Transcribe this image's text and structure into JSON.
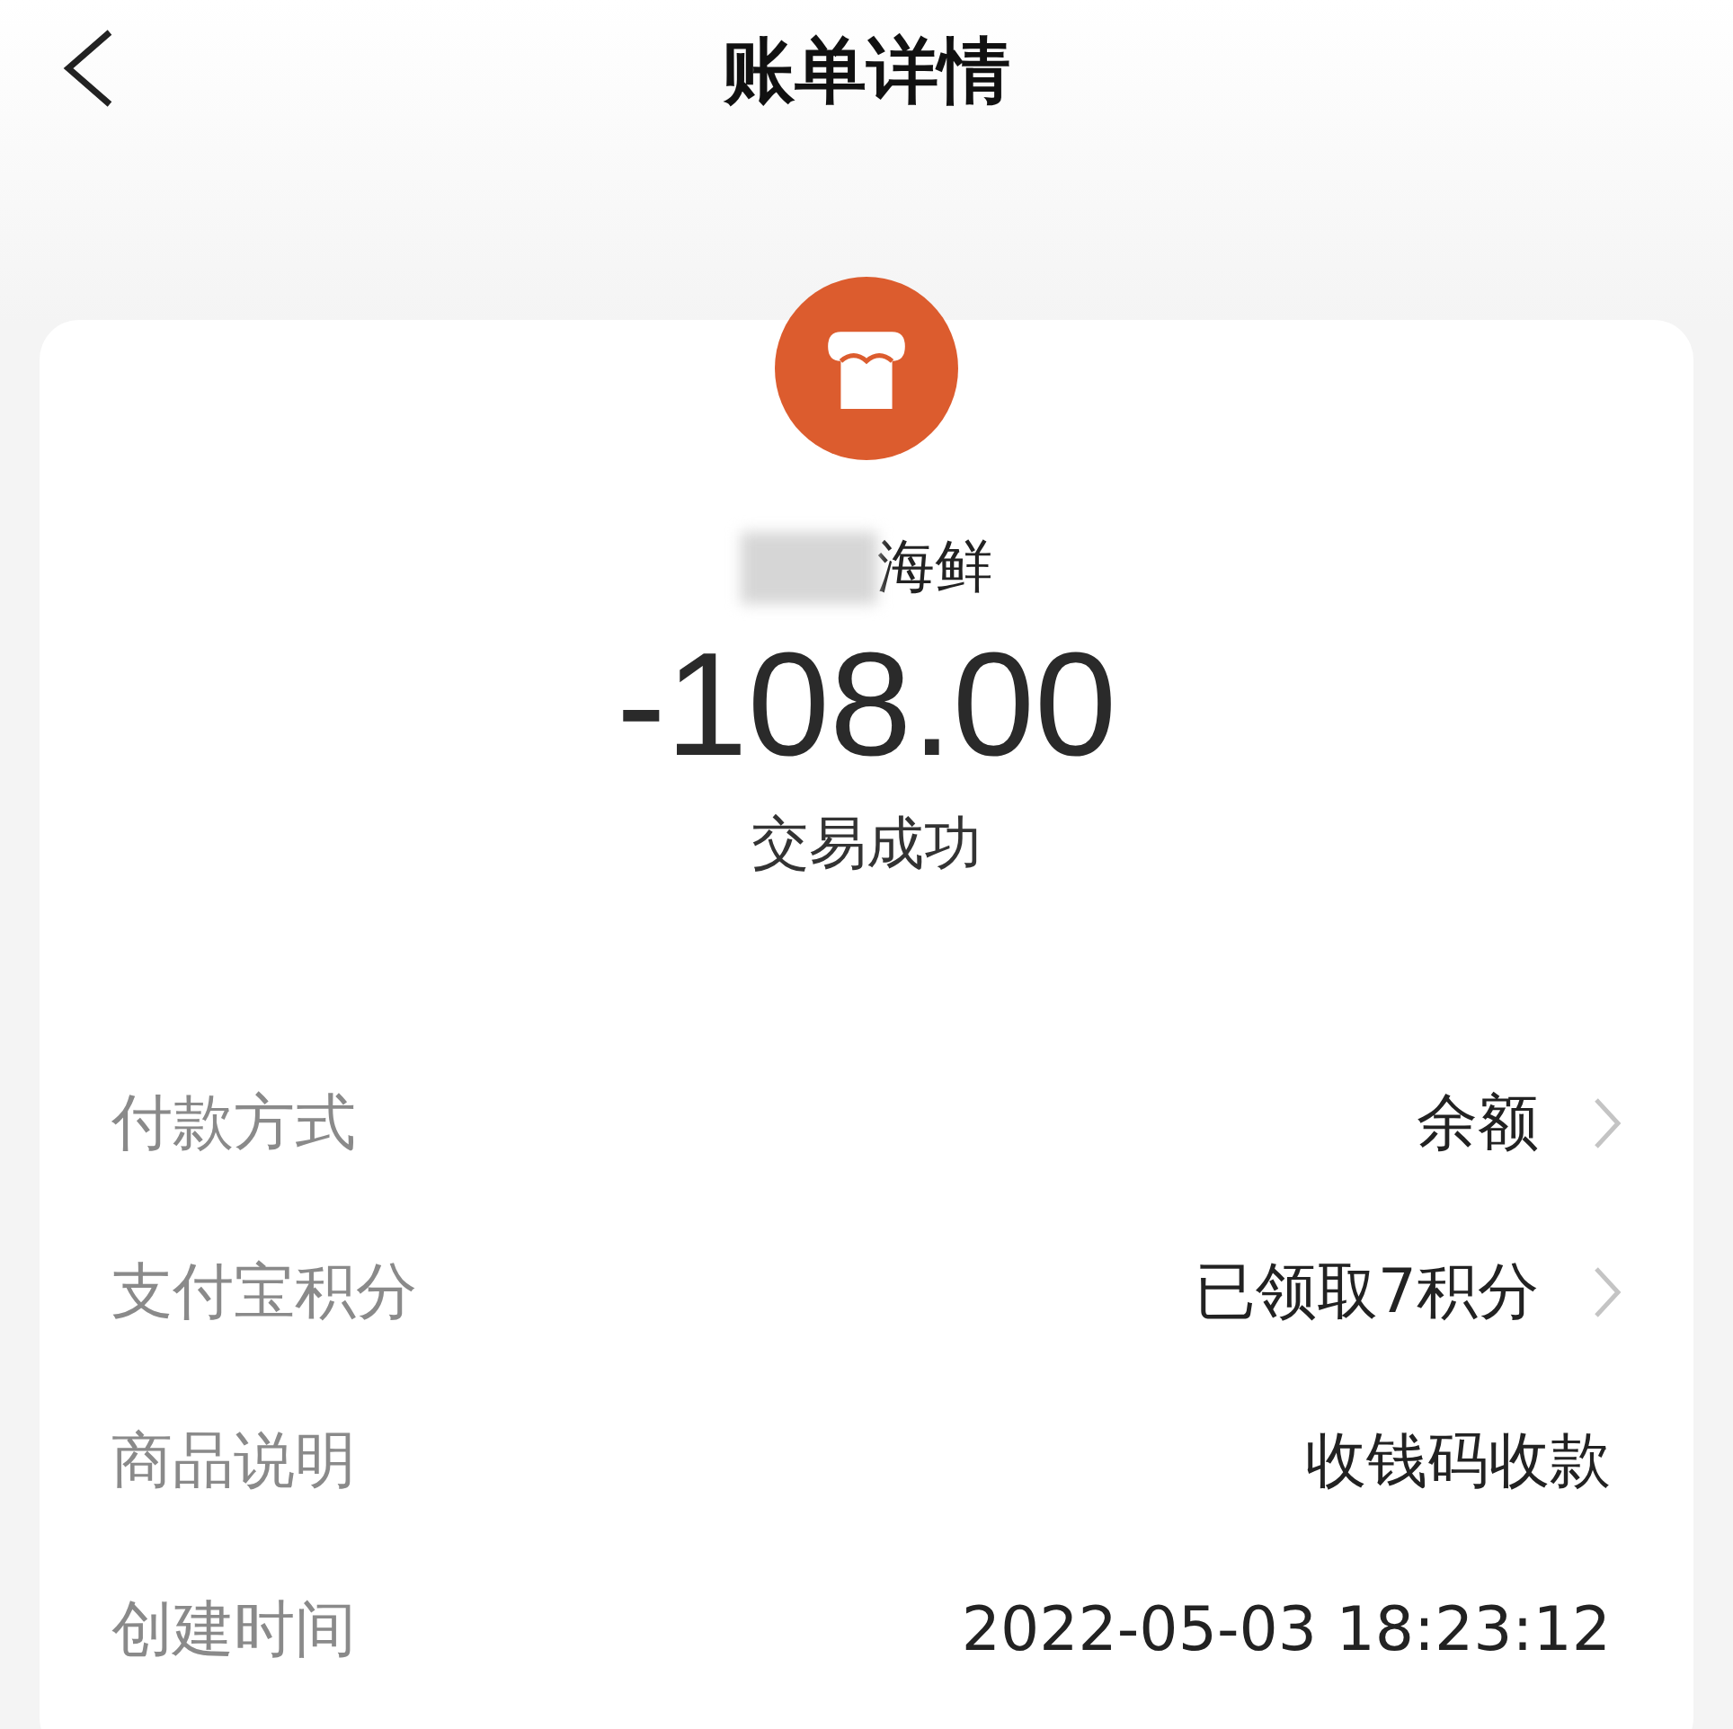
{
  "header": {
    "title": "账单详情"
  },
  "merchant": {
    "name": "海鲜",
    "name_redacted": true
  },
  "amount": "-108.00",
  "status": "交易成功",
  "rows": [
    {
      "label": "付款方式",
      "value": "余额",
      "has_arrow": true
    },
    {
      "label": "支付宝积分",
      "value": "已领取7积分",
      "has_arrow": true
    },
    {
      "label": "商品说明",
      "value": "收钱码收款",
      "has_arrow": false
    },
    {
      "label": "创建时间",
      "value": "2022-05-03 18:23:12",
      "has_arrow": false
    }
  ]
}
